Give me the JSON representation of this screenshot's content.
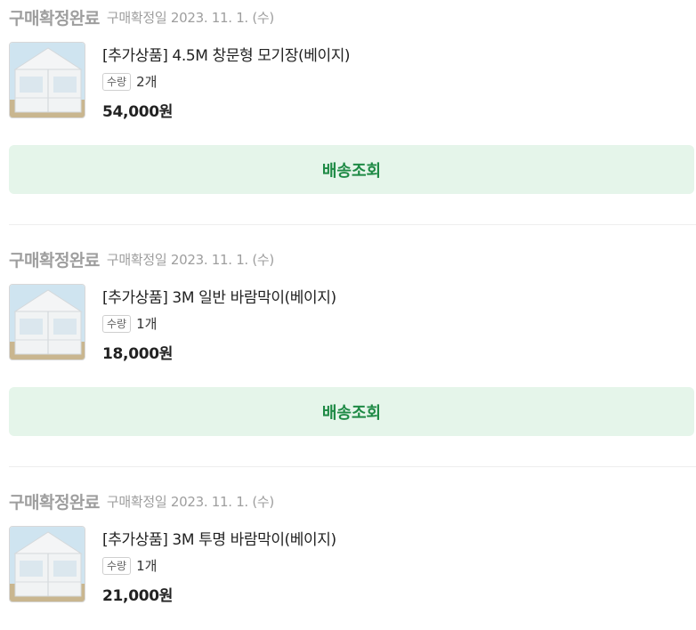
{
  "orders": [
    {
      "status": "구매확정완료",
      "date": "구매확정일 2023. 11. 1. (수)",
      "title": "[추가상품] 4.5M 창문형 모기장(베이지)",
      "qty_label": "수량",
      "qty": "2개",
      "price": "54,000원",
      "button": "배송조회"
    },
    {
      "status": "구매확정완료",
      "date": "구매확정일 2023. 11. 1. (수)",
      "title": "[추가상품] 3M 일반 바람막이(베이지)",
      "qty_label": "수량",
      "qty": "1개",
      "price": "18,000원",
      "button": "배송조회"
    },
    {
      "status": "구매확정완료",
      "date": "구매확정일 2023. 11. 1. (수)",
      "title": "[추가상품] 3M 투명 바람막이(베이지)",
      "qty_label": "수량",
      "qty": "1개",
      "price": "21,000원"
    }
  ],
  "colors": {
    "status_text": "#9e9e9e",
    "button_bg": "#e5f5ea",
    "button_text": "#1e8a45"
  },
  "icons": {
    "product_thumbnail": "white-tent-image"
  }
}
